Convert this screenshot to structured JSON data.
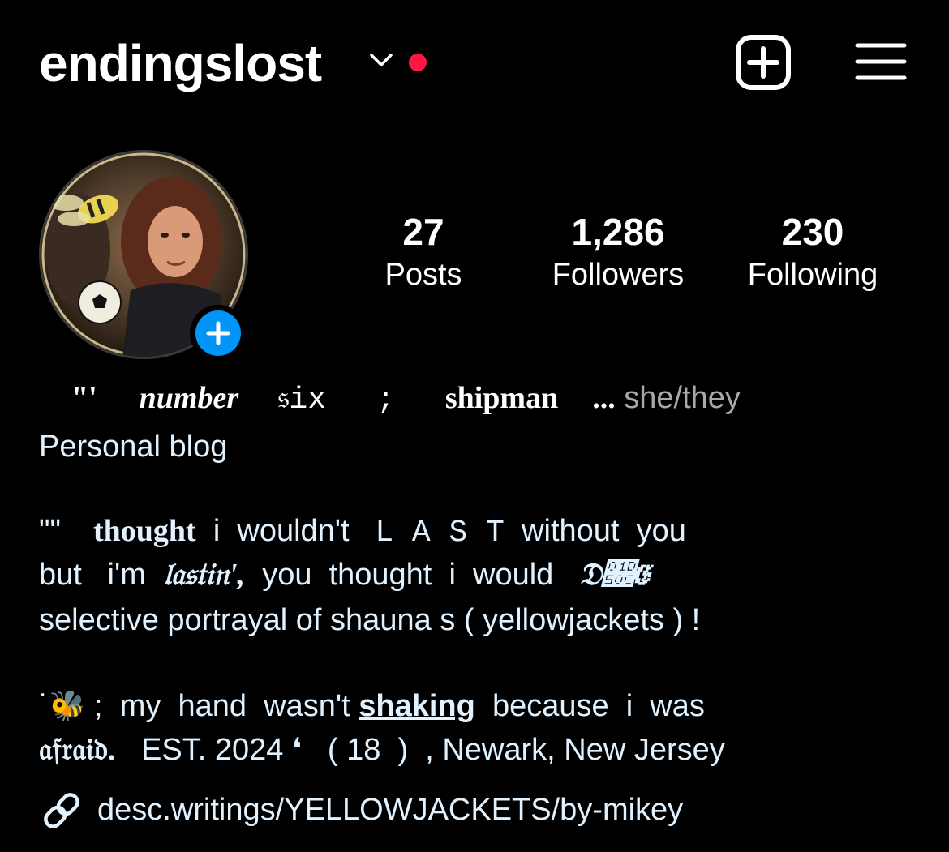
{
  "header": {
    "username": "endingslost"
  },
  "stats": {
    "posts_count": "27",
    "posts_label": "Posts",
    "followers_count": "1,286",
    "followers_label": "Followers",
    "following_count": "230",
    "following_label": "Following"
  },
  "bio": {
    "name_parts": [
      "\"'",
      "number",
      "𝔰ix",
      ";",
      "shipman",
      "...",
      "she/they"
    ],
    "category": "Personal blog",
    "line1": [
      "\"\"",
      "thought",
      "i  wouldn't",
      "L A S T",
      "without  you"
    ],
    "line2": [
      "but   i'm",
      "𝔩𝔞𝔰𝔱𝔦𝔫',",
      "you  thought  i  would",
      "𝔇𝔌𝔈"
    ],
    "line3": "selective portrayal of shauna s ( yellowjackets ) !",
    "line4": [
      "˙",
      "🐝",
      " ;  my  hand  wasn't ",
      "shaking",
      "  because  i  was"
    ],
    "line5": [
      "𝔞𝔣𝔯𝔞𝔦𝔡.",
      "   EST. 2024 ❛   ( 18  )  , Newark, New Jersey"
    ],
    "link": "desc.writings/YELLOWJACKETS/by-mikey"
  },
  "colors": {
    "background": "#000000",
    "text": "#ffffff",
    "link_text": "#e0f1ff",
    "muted": "#a8a8a8",
    "notification_dot": "#ff1744",
    "add_story": "#0095f6"
  },
  "icons": {
    "chevron": "chevron-down-icon",
    "new_post": "plus-square-icon",
    "menu": "hamburger-menu-icon",
    "add_story": "plus-icon",
    "link": "link-chain-icon"
  }
}
